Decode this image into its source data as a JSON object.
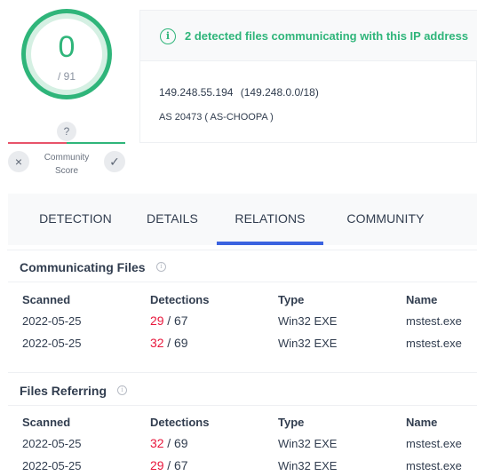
{
  "score": {
    "value": "0",
    "total": "/ 91"
  },
  "community": {
    "badge": "?",
    "label_line1": "Community",
    "label_line2": "Score",
    "down_icon": "×",
    "up_icon": "✓"
  },
  "alert": {
    "text": "2 detected files communicating with this IP address",
    "icon": "i",
    "color": "#2fb57a"
  },
  "ip": {
    "address": "149.248.55.194",
    "range": "(149.248.0.0/18)",
    "as_line": "AS 20473 ( AS-CHOOPA )"
  },
  "tabs": [
    {
      "label": "DETECTION"
    },
    {
      "label": "DETAILS"
    },
    {
      "label": "RELATIONS"
    },
    {
      "label": "COMMUNITY"
    }
  ],
  "active_tab": "RELATIONS",
  "colors": {
    "accent": "#3c64e0",
    "malicious": "#e8183d",
    "clean": "#2fb57a"
  },
  "communicating": {
    "title": "Communicating Files",
    "columns": [
      "Scanned",
      "Detections",
      "Type",
      "Name"
    ],
    "rows": [
      {
        "scanned": "2022-05-25",
        "det": "29",
        "total": "/ 67",
        "type": "Win32 EXE",
        "name": "mstest.exe"
      },
      {
        "scanned": "2022-05-25",
        "det": "32",
        "total": "/ 69",
        "type": "Win32 EXE",
        "name": "mstest.exe"
      }
    ]
  },
  "referring": {
    "title": "Files Referring",
    "columns": [
      "Scanned",
      "Detections",
      "Type",
      "Name"
    ],
    "rows": [
      {
        "scanned": "2022-05-25",
        "det": "32",
        "total": "/ 69",
        "type": "Win32 EXE",
        "name": "mstest.exe"
      },
      {
        "scanned": "2022-05-25",
        "det": "29",
        "total": "/ 67",
        "type": "Win32 EXE",
        "name": "mstest.exe"
      }
    ]
  }
}
